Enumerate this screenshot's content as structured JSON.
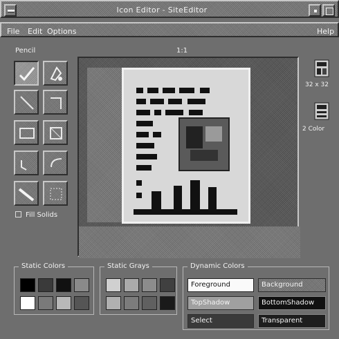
{
  "window": {
    "title": "Icon Editor - SiteEditor",
    "menu": [
      "File",
      "Edit",
      "Options"
    ],
    "help": "Help"
  },
  "toolbar": {
    "header": "Pencil",
    "zoom": "1:1",
    "fill_label": "Fill Solids"
  },
  "tools": [
    "pencil-icon",
    "flood-fill-icon",
    "line-icon",
    "polyline-icon",
    "rectangle-icon",
    "polygon-icon",
    "circle-icon",
    "ellipse-icon",
    "eraser-icon",
    "select-icon"
  ],
  "canvas": {
    "size_label": "32 x 32",
    "depth_label": "2 Color"
  },
  "palettes": {
    "static_colors": {
      "title": "Static Colors",
      "swatches": [
        "#000000",
        "#3a3a3a",
        "#111111",
        "#8a8a8a",
        "#ffffff",
        "#7a7a7a",
        "#b8b8b8",
        "#555555"
      ]
    },
    "static_grays": {
      "title": "Static Grays",
      "swatches": [
        "#d0d0d0",
        "#aaaaaa",
        "#8c8c8c",
        "#404040",
        "#b0b0b0",
        "#7c7c7c",
        "#606060",
        "#1a1a1a"
      ]
    },
    "dynamic_colors": {
      "title": "Dynamic Colors",
      "buttons": [
        "Foreground",
        "Background",
        "TopShadow",
        "BottomShadow",
        "Select",
        "Transparent"
      ]
    }
  },
  "colors": {
    "face": "#6e6e6e",
    "light": "#c8c8c8",
    "dark": "#2e2e2e",
    "text": "#f2f2f2"
  }
}
